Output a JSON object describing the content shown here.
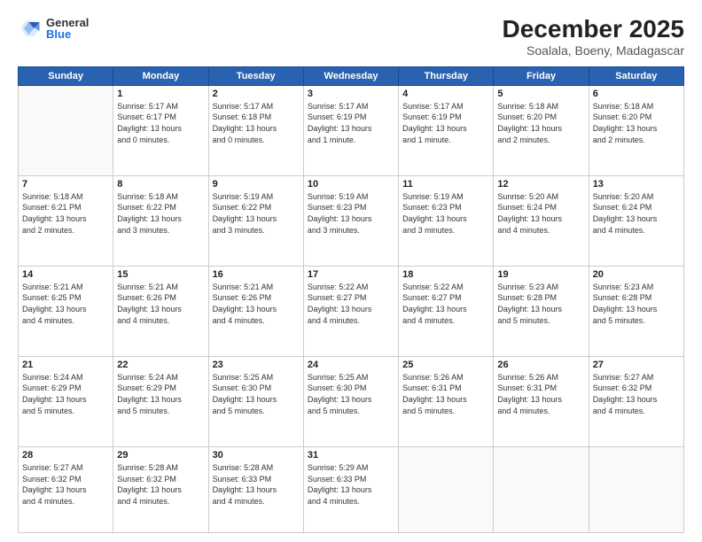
{
  "header": {
    "logo_general": "General",
    "logo_blue": "Blue",
    "month": "December 2025",
    "location": "Soalala, Boeny, Madagascar"
  },
  "weekdays": [
    "Sunday",
    "Monday",
    "Tuesday",
    "Wednesday",
    "Thursday",
    "Friday",
    "Saturday"
  ],
  "weeks": [
    [
      {
        "day": "",
        "info": ""
      },
      {
        "day": "1",
        "info": "Sunrise: 5:17 AM\nSunset: 6:17 PM\nDaylight: 13 hours\nand 0 minutes."
      },
      {
        "day": "2",
        "info": "Sunrise: 5:17 AM\nSunset: 6:18 PM\nDaylight: 13 hours\nand 0 minutes."
      },
      {
        "day": "3",
        "info": "Sunrise: 5:17 AM\nSunset: 6:19 PM\nDaylight: 13 hours\nand 1 minute."
      },
      {
        "day": "4",
        "info": "Sunrise: 5:17 AM\nSunset: 6:19 PM\nDaylight: 13 hours\nand 1 minute."
      },
      {
        "day": "5",
        "info": "Sunrise: 5:18 AM\nSunset: 6:20 PM\nDaylight: 13 hours\nand 2 minutes."
      },
      {
        "day": "6",
        "info": "Sunrise: 5:18 AM\nSunset: 6:20 PM\nDaylight: 13 hours\nand 2 minutes."
      }
    ],
    [
      {
        "day": "7",
        "info": "Sunrise: 5:18 AM\nSunset: 6:21 PM\nDaylight: 13 hours\nand 2 minutes."
      },
      {
        "day": "8",
        "info": "Sunrise: 5:18 AM\nSunset: 6:22 PM\nDaylight: 13 hours\nand 3 minutes."
      },
      {
        "day": "9",
        "info": "Sunrise: 5:19 AM\nSunset: 6:22 PM\nDaylight: 13 hours\nand 3 minutes."
      },
      {
        "day": "10",
        "info": "Sunrise: 5:19 AM\nSunset: 6:23 PM\nDaylight: 13 hours\nand 3 minutes."
      },
      {
        "day": "11",
        "info": "Sunrise: 5:19 AM\nSunset: 6:23 PM\nDaylight: 13 hours\nand 3 minutes."
      },
      {
        "day": "12",
        "info": "Sunrise: 5:20 AM\nSunset: 6:24 PM\nDaylight: 13 hours\nand 4 minutes."
      },
      {
        "day": "13",
        "info": "Sunrise: 5:20 AM\nSunset: 6:24 PM\nDaylight: 13 hours\nand 4 minutes."
      }
    ],
    [
      {
        "day": "14",
        "info": "Sunrise: 5:21 AM\nSunset: 6:25 PM\nDaylight: 13 hours\nand 4 minutes."
      },
      {
        "day": "15",
        "info": "Sunrise: 5:21 AM\nSunset: 6:26 PM\nDaylight: 13 hours\nand 4 minutes."
      },
      {
        "day": "16",
        "info": "Sunrise: 5:21 AM\nSunset: 6:26 PM\nDaylight: 13 hours\nand 4 minutes."
      },
      {
        "day": "17",
        "info": "Sunrise: 5:22 AM\nSunset: 6:27 PM\nDaylight: 13 hours\nand 4 minutes."
      },
      {
        "day": "18",
        "info": "Sunrise: 5:22 AM\nSunset: 6:27 PM\nDaylight: 13 hours\nand 4 minutes."
      },
      {
        "day": "19",
        "info": "Sunrise: 5:23 AM\nSunset: 6:28 PM\nDaylight: 13 hours\nand 5 minutes."
      },
      {
        "day": "20",
        "info": "Sunrise: 5:23 AM\nSunset: 6:28 PM\nDaylight: 13 hours\nand 5 minutes."
      }
    ],
    [
      {
        "day": "21",
        "info": "Sunrise: 5:24 AM\nSunset: 6:29 PM\nDaylight: 13 hours\nand 5 minutes."
      },
      {
        "day": "22",
        "info": "Sunrise: 5:24 AM\nSunset: 6:29 PM\nDaylight: 13 hours\nand 5 minutes."
      },
      {
        "day": "23",
        "info": "Sunrise: 5:25 AM\nSunset: 6:30 PM\nDaylight: 13 hours\nand 5 minutes."
      },
      {
        "day": "24",
        "info": "Sunrise: 5:25 AM\nSunset: 6:30 PM\nDaylight: 13 hours\nand 5 minutes."
      },
      {
        "day": "25",
        "info": "Sunrise: 5:26 AM\nSunset: 6:31 PM\nDaylight: 13 hours\nand 5 minutes."
      },
      {
        "day": "26",
        "info": "Sunrise: 5:26 AM\nSunset: 6:31 PM\nDaylight: 13 hours\nand 4 minutes."
      },
      {
        "day": "27",
        "info": "Sunrise: 5:27 AM\nSunset: 6:32 PM\nDaylight: 13 hours\nand 4 minutes."
      }
    ],
    [
      {
        "day": "28",
        "info": "Sunrise: 5:27 AM\nSunset: 6:32 PM\nDaylight: 13 hours\nand 4 minutes."
      },
      {
        "day": "29",
        "info": "Sunrise: 5:28 AM\nSunset: 6:32 PM\nDaylight: 13 hours\nand 4 minutes."
      },
      {
        "day": "30",
        "info": "Sunrise: 5:28 AM\nSunset: 6:33 PM\nDaylight: 13 hours\nand 4 minutes."
      },
      {
        "day": "31",
        "info": "Sunrise: 5:29 AM\nSunset: 6:33 PM\nDaylight: 13 hours\nand 4 minutes."
      },
      {
        "day": "",
        "info": ""
      },
      {
        "day": "",
        "info": ""
      },
      {
        "day": "",
        "info": ""
      }
    ]
  ]
}
